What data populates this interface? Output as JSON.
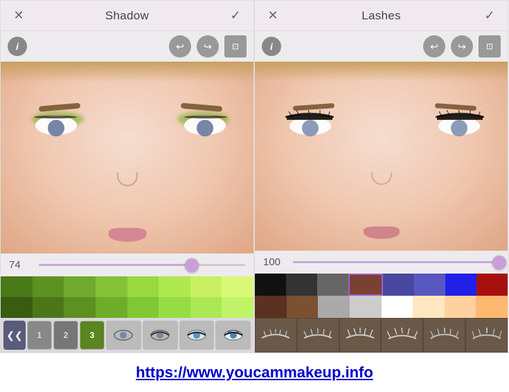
{
  "left_panel": {
    "title": "Shadow",
    "close_label": "✕",
    "check_label": "✓",
    "info_label": "i",
    "slider_value": "74",
    "slider_percent": 74,
    "colors": [
      {
        "hex": "#5a8a20",
        "row": 0
      },
      {
        "hex": "#70a030",
        "row": 0
      },
      {
        "hex": "#88bc40",
        "row": 0
      },
      {
        "hex": "#9ad050",
        "row": 0
      },
      {
        "hex": "#b0e060",
        "row": 0
      },
      {
        "hex": "#c8f070",
        "row": 0
      },
      {
        "hex": "#d8f888",
        "row": 0
      },
      {
        "hex": "#e8fca0",
        "row": 0
      },
      {
        "hex": "#406820",
        "row": 1
      },
      {
        "hex": "#509030",
        "row": 1
      },
      {
        "hex": "#60a840",
        "row": 1
      },
      {
        "hex": "#70c050",
        "row": 1
      },
      {
        "hex": "#80d860",
        "row": 1
      },
      {
        "hex": "#90e870",
        "row": 1
      },
      {
        "hex": "#a8f080",
        "row": 1
      },
      {
        "hex": "#c0f898",
        "row": 1
      }
    ],
    "tools": [
      {
        "label": "1",
        "active": false,
        "type": "number"
      },
      {
        "label": "2",
        "active": false,
        "type": "number"
      },
      {
        "label": "3",
        "active": true,
        "type": "number"
      },
      {
        "label": "eye1",
        "active": false,
        "type": "eye"
      },
      {
        "label": "eye2",
        "active": false,
        "type": "eye"
      },
      {
        "label": "eye3",
        "active": false,
        "type": "eye"
      },
      {
        "label": "eye4",
        "active": false,
        "type": "eye"
      }
    ]
  },
  "right_panel": {
    "title": "Lashes",
    "close_label": "✕",
    "check_label": "✓",
    "info_label": "i",
    "slider_value": "100",
    "slider_percent": 100,
    "lash_colors_row1": [
      {
        "hex": "#111111"
      },
      {
        "hex": "#333333"
      },
      {
        "hex": "#666666"
      },
      {
        "hex": "#7a4030",
        "selected": true
      },
      {
        "hex": "#4040a0"
      },
      {
        "hex": "#6060c0"
      },
      {
        "hex": "#3030ff"
      },
      {
        "hex": "#aa0000"
      }
    ],
    "lash_colors_row2": [
      {
        "hex": "#6b4030"
      },
      {
        "hex": "#8b6040"
      },
      {
        "hex": "#aaaaaa"
      },
      {
        "hex": "#cccccc"
      },
      {
        "hex": "#ffffff"
      },
      {
        "hex": "#ffeecc"
      },
      {
        "hex": "#ffe0b0"
      },
      {
        "hex": "#ffd090"
      }
    ],
    "lash_styles": [
      {
        "label": "style1"
      },
      {
        "label": "style2"
      },
      {
        "label": "style3"
      },
      {
        "label": "style4"
      },
      {
        "label": "style5"
      },
      {
        "label": "style6"
      }
    ]
  },
  "footer": {
    "url": "https://www.youcammakeup.info"
  }
}
